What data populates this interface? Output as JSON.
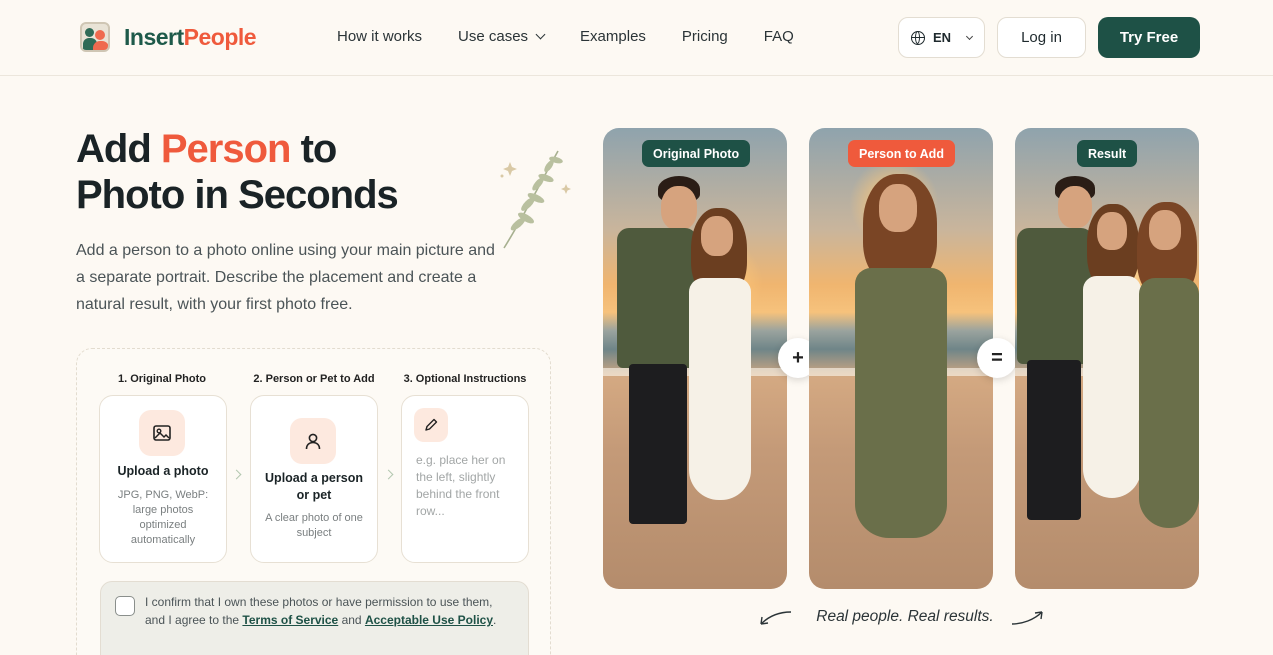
{
  "brand": {
    "name_part1": "Insert",
    "name_part2": "People",
    "color_primary": "#1e5146",
    "color_accent": "#ef5a3c"
  },
  "nav": {
    "items": [
      {
        "label": "How it works"
      },
      {
        "label": "Use cases",
        "has_dropdown": true
      },
      {
        "label": "Examples"
      },
      {
        "label": "Pricing"
      },
      {
        "label": "FAQ"
      }
    ],
    "language": "EN",
    "login_label": "Log in",
    "cta_label": "Try Free"
  },
  "hero": {
    "title_part1": "Add ",
    "title_accent": "Person",
    "title_part2": " to",
    "title_line2": "Photo in Seconds",
    "description": "Add a person to a photo online using your main picture and a separate portrait. Describe the placement and create a natural result, with your first photo free."
  },
  "uploader": {
    "steps": [
      {
        "label": "1. Original Photo",
        "title": "Upload a photo",
        "subtitle": "JPG, PNG, WebP: large photos optimized automatically",
        "icon": "image-icon"
      },
      {
        "label": "2. Person or Pet to Add",
        "title": "Upload a person or pet",
        "subtitle": "A clear photo of one subject",
        "icon": "person-icon"
      },
      {
        "label": "3. Optional Instructions",
        "placeholder": "e.g. place her on the left, slightly behind the front row...",
        "icon": "pencil-icon"
      }
    ],
    "consent": {
      "text_before": "I confirm that I own these photos or have permission to use them, and I agree to the ",
      "terms_label": "Terms of Service",
      "text_middle": " and ",
      "policy_label": "Acceptable Use Policy",
      "text_after": ".",
      "checked": false
    }
  },
  "showcase": {
    "badges": [
      {
        "label": "Original Photo",
        "color": "#1e5146"
      },
      {
        "label": "Person to Add",
        "color": "#ef5a3c"
      },
      {
        "label": "Result",
        "color": "#1e5146"
      }
    ],
    "plus_symbol": "+",
    "equals_symbol": "=",
    "tagline": "Real people. Real results."
  }
}
